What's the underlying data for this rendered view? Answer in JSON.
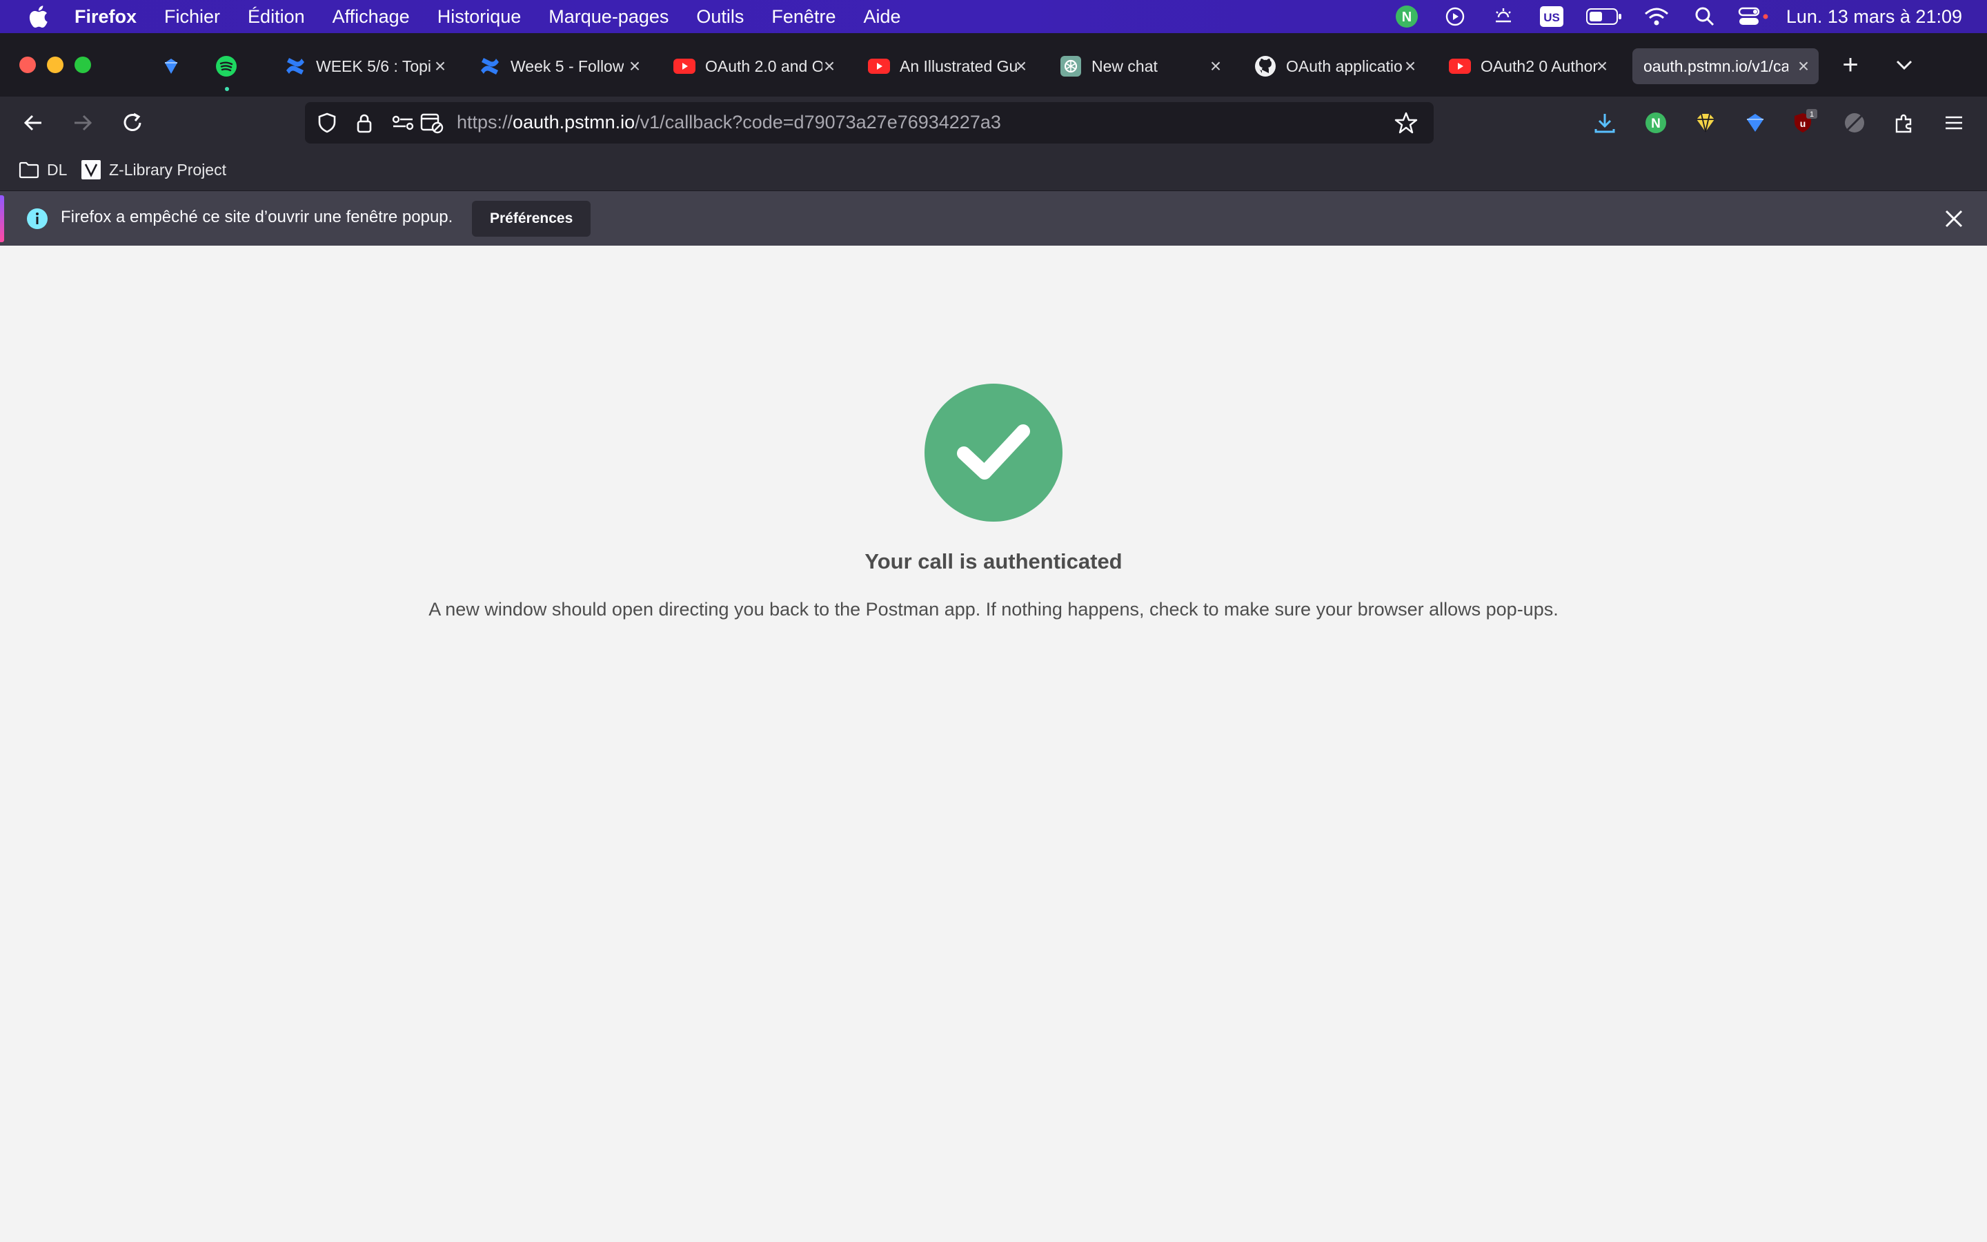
{
  "menubar": {
    "app_name": "Firefox",
    "items": [
      "Fichier",
      "Édition",
      "Affichage",
      "Historique",
      "Marque-pages",
      "Outils",
      "Fenêtre",
      "Aide"
    ],
    "input_source": "US",
    "clock": "Lun. 13 mars à  21:09"
  },
  "tabs": [
    {
      "title": "",
      "icon": "diamond-icon"
    },
    {
      "title": "",
      "icon": "spotify-icon"
    },
    {
      "title": "WEEK 5/6 : Topi",
      "icon": "confluence-icon"
    },
    {
      "title": "Week 5 - Follow",
      "icon": "confluence-icon"
    },
    {
      "title": "OAuth 2.0 and O",
      "icon": "youtube-icon"
    },
    {
      "title": "An Illustrated Gu",
      "icon": "youtube-icon"
    },
    {
      "title": "New chat",
      "icon": "openai-icon"
    },
    {
      "title": "OAuth applicatio",
      "icon": "github-icon"
    },
    {
      "title": "OAuth2 0 Author",
      "icon": "youtube-icon"
    },
    {
      "title": "oauth.pstmn.io/v1/ca",
      "icon": "",
      "active": true
    }
  ],
  "urlbar": {
    "scheme": "https://",
    "host": "oauth.pstmn.io",
    "path": "/v1/callback?code=d79073a27e76934227a3"
  },
  "bookmarks": [
    {
      "label": "DL",
      "icon": "folder-icon"
    },
    {
      "label": "Z-Library Project",
      "icon": "zlibrary-icon"
    }
  ],
  "notification": {
    "message": "Firefox a empêché ce site d’ouvrir une fenêtre popup.",
    "button": "Préférences"
  },
  "page": {
    "title": "Your call is authenticated",
    "description": "A new window should open directing you back to the Postman app. If nothing happens, check to make sure your browser allows pop-ups."
  },
  "colors": {
    "menubar": "#3b1fae",
    "tabstrip": "#1c1b22",
    "toolbar": "#2b2a33",
    "success": "#57b17f",
    "page_bg": "#f3f3f3"
  }
}
